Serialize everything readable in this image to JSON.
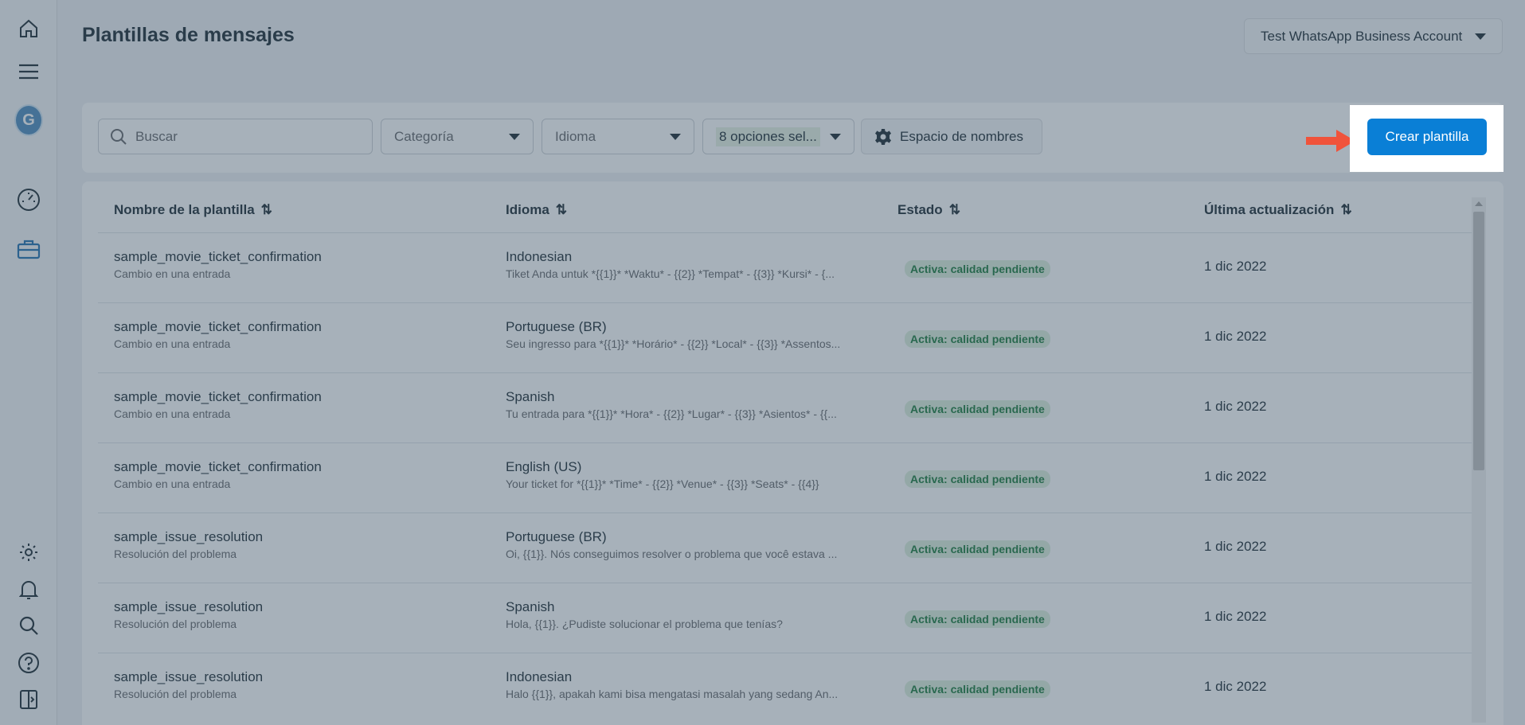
{
  "header": {
    "title": "Plantillas de mensajes",
    "account_label": "Test WhatsApp Business Account"
  },
  "rail": {
    "avatar_letter": "G",
    "icons": [
      "home-icon",
      "menu-icon",
      "avatar",
      "dashboard-icon",
      "briefcase-icon",
      "gear-icon",
      "bell-icon",
      "search-icon",
      "help-icon",
      "sidebar-toggle-icon"
    ]
  },
  "filters": {
    "search_placeholder": "Buscar",
    "category_label": "Categoría",
    "language_label": "Idioma",
    "status_label": "8 opciones sel...",
    "namespace_label": "Espacio de nombres",
    "create_label": "Crear plantilla"
  },
  "table": {
    "headers": {
      "name": "Nombre de la plantilla",
      "language": "Idioma",
      "status": "Estado",
      "updated": "Última actualización"
    },
    "rows": [
      {
        "name": "sample_movie_ticket_confirmation",
        "category": "Cambio en una entrada",
        "language": "Indonesian",
        "preview": "Tiket Anda untuk *{{1}}* *Waktu* - {{2}} *Tempat* - {{3}} *Kursi* - {...",
        "status": "Activa: calidad pendiente",
        "date": "1 dic 2022"
      },
      {
        "name": "sample_movie_ticket_confirmation",
        "category": "Cambio en una entrada",
        "language": "Portuguese (BR)",
        "preview": "Seu ingresso para *{{1}}* *Horário* - {{2}} *Local* - {{3}} *Assentos...",
        "status": "Activa: calidad pendiente",
        "date": "1 dic 2022"
      },
      {
        "name": "sample_movie_ticket_confirmation",
        "category": "Cambio en una entrada",
        "language": "Spanish",
        "preview": "Tu entrada para *{{1}}* *Hora* - {{2}} *Lugar* - {{3}} *Asientos* - {{...",
        "status": "Activa: calidad pendiente",
        "date": "1 dic 2022"
      },
      {
        "name": "sample_movie_ticket_confirmation",
        "category": "Cambio en una entrada",
        "language": "English (US)",
        "preview": "Your ticket for *{{1}}* *Time* - {{2}} *Venue* - {{3}} *Seats* - {{4}}",
        "status": "Activa: calidad pendiente",
        "date": "1 dic 2022"
      },
      {
        "name": "sample_issue_resolution",
        "category": "Resolución del problema",
        "language": "Portuguese (BR)",
        "preview": "Oi, {{1}}. Nós conseguimos resolver o problema que você estava ...",
        "status": "Activa: calidad pendiente",
        "date": "1 dic 2022"
      },
      {
        "name": "sample_issue_resolution",
        "category": "Resolución del problema",
        "language": "Spanish",
        "preview": "Hola, {{1}}. ¿Pudiste solucionar el problema que tenías?",
        "status": "Activa: calidad pendiente",
        "date": "1 dic 2022"
      },
      {
        "name": "sample_issue_resolution",
        "category": "Resolución del problema",
        "language": "Indonesian",
        "preview": "Halo {{1}}, apakah kami bisa mengatasi masalah yang sedang An...",
        "status": "Activa: calidad pendiente",
        "date": "1 dic 2022"
      }
    ]
  },
  "colors": {
    "primary": "#0a7fd6",
    "arrow": "#f0533b",
    "status_green": "#1a7a3c"
  }
}
